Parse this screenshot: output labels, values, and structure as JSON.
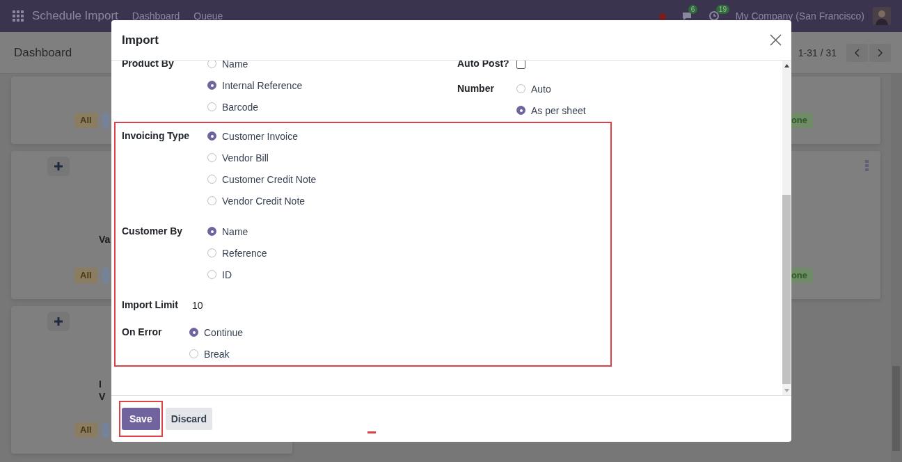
{
  "navbar": {
    "app_name": "Schedule Import",
    "menu": [
      "Dashboard",
      "Queue"
    ],
    "messages_count": "6",
    "activities_count": "19",
    "company": "My Company (San Francisco)"
  },
  "control_panel": {
    "breadcrumb": "Dashboard",
    "pager": "1-31 / 31"
  },
  "kanban_rows": [
    {
      "left": {
        "add_button": false,
        "badge": "All"
      },
      "right": {
        "menu": false,
        "badge": "one"
      }
    },
    {
      "left": {
        "add_button": true,
        "title_lines": [
          "Va"
        ],
        "badge": "All"
      },
      "right": {
        "menu": true,
        "badge": "one"
      }
    },
    {
      "left": {
        "add_button": true,
        "title_lines": [
          "I",
          "V"
        ],
        "badge": "All"
      }
    }
  ],
  "dialog": {
    "title": "Import",
    "fields_left": [
      {
        "label": "Product By",
        "kind": "radio",
        "options": [
          {
            "label": "Name",
            "selected": false
          },
          {
            "label": "Internal Reference",
            "selected": true
          },
          {
            "label": "Barcode",
            "selected": false
          }
        ]
      }
    ],
    "fields_right": [
      {
        "label": "Auto Post?",
        "kind": "checkbox",
        "checked": false
      },
      {
        "label": "Number",
        "kind": "radio",
        "options": [
          {
            "label": "Auto",
            "selected": false
          },
          {
            "label": "As per sheet",
            "selected": true
          }
        ]
      }
    ],
    "highlighted_fields": [
      {
        "label": "Invoicing Type",
        "kind": "radio",
        "compact": false,
        "options": [
          {
            "label": "Customer Invoice",
            "selected": true
          },
          {
            "label": "Vendor Bill",
            "selected": false
          },
          {
            "label": "Customer Credit Note",
            "selected": false
          },
          {
            "label": "Vendor Credit Note",
            "selected": false
          }
        ]
      },
      {
        "label": "Customer By",
        "kind": "radio",
        "compact": false,
        "options": [
          {
            "label": "Name",
            "selected": true
          },
          {
            "label": "Reference",
            "selected": false
          },
          {
            "label": "ID",
            "selected": false
          }
        ]
      },
      {
        "label": "Import Limit",
        "kind": "value",
        "compact": true,
        "value": "10"
      },
      {
        "label": "On Error",
        "kind": "radio",
        "compact": true,
        "options": [
          {
            "label": "Continue",
            "selected": true
          },
          {
            "label": "Break",
            "selected": false
          }
        ]
      }
    ],
    "buttons": [
      {
        "label": "Save",
        "kind": "primary",
        "highlighted": true
      },
      {
        "label": "Discard",
        "kind": "secondary",
        "highlighted": false
      }
    ]
  }
}
